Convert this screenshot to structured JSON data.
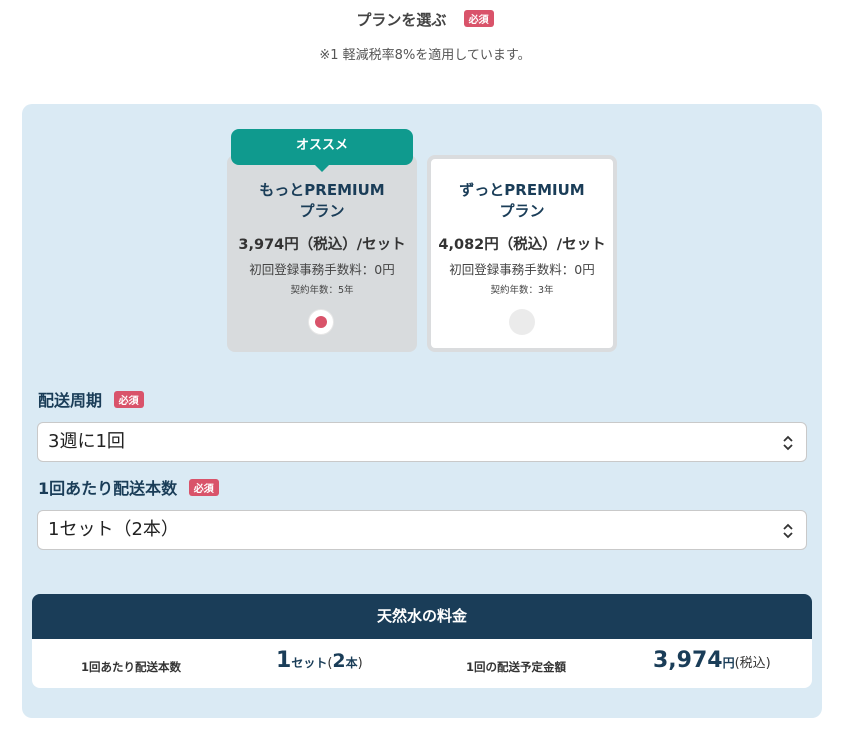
{
  "header": {
    "title": "プランを選ぶ",
    "required_badge": "必須",
    "note": "※1 軽減税率8%を適用しています。"
  },
  "plans": [
    {
      "recommend_label": "オススメ",
      "name_line1": "もっとPREMIUM",
      "name_line2": "プラン",
      "price": "3,974円（税込）/セット",
      "fee": "初回登録事務手数料：0円",
      "term": "契約年数：5年",
      "selected": true
    },
    {
      "name_line1": "ずっとPREMIUM",
      "name_line2": "プラン",
      "price": "4,082円（税込）/セット",
      "fee": "初回登録事務手数料：0円",
      "term": "契約年数：3年",
      "selected": false
    }
  ],
  "delivery_cycle": {
    "label": "配送周期",
    "badge": "必須",
    "value": "3週に1回"
  },
  "delivery_quantity": {
    "label": "1回あたり配送本数",
    "badge": "必須",
    "value": "1セット（2本）"
  },
  "summary": {
    "title": "天然水の料金",
    "qty_label": "1回あたり配送本数",
    "qty_num": "1",
    "qty_unit": "セット",
    "qty_paren_open": "(",
    "qty_bottles": "2",
    "qty_bottles_unit": "本",
    "qty_paren_close": ")",
    "amount_label": "1回の配送予定金額",
    "amount_value": "3,974",
    "amount_unit": "円",
    "amount_tax": "(税込)"
  },
  "colors": {
    "accent_red": "#d9536a",
    "teal": "#0f9a8e",
    "navy": "#1a3d58",
    "panel_bg": "#daeaf4"
  }
}
